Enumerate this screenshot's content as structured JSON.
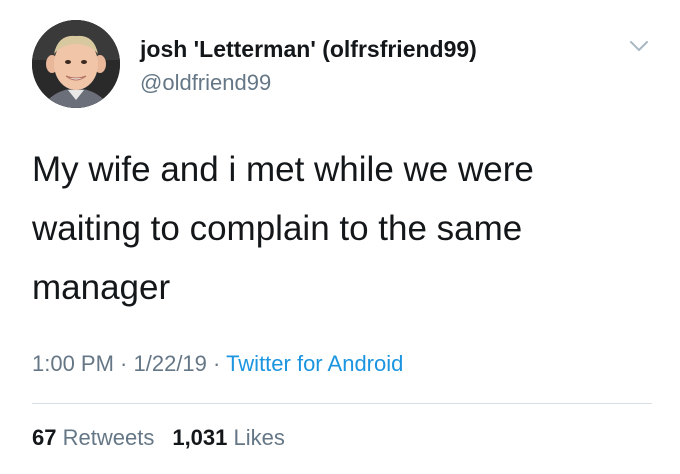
{
  "user": {
    "display_name": "josh 'Letterman' (olfrsfriend99)",
    "handle": "@oldfriend99",
    "avatar_icon": "profile-photo"
  },
  "tweet": {
    "text": "My wife and i met while we were waiting to complain to the same manager",
    "time": "1:00 PM",
    "separator": " · ",
    "date": "1/22/19",
    "source": "Twitter for Android"
  },
  "stats": {
    "retweets_count": "67",
    "retweets_label": "Retweets",
    "likes_count": "1,031",
    "likes_label": "Likes"
  },
  "icons": {
    "menu": "chevron-down-icon"
  },
  "colors": {
    "link": "#1b95e0",
    "secondary_text": "#657786",
    "primary_text": "#14171a"
  }
}
